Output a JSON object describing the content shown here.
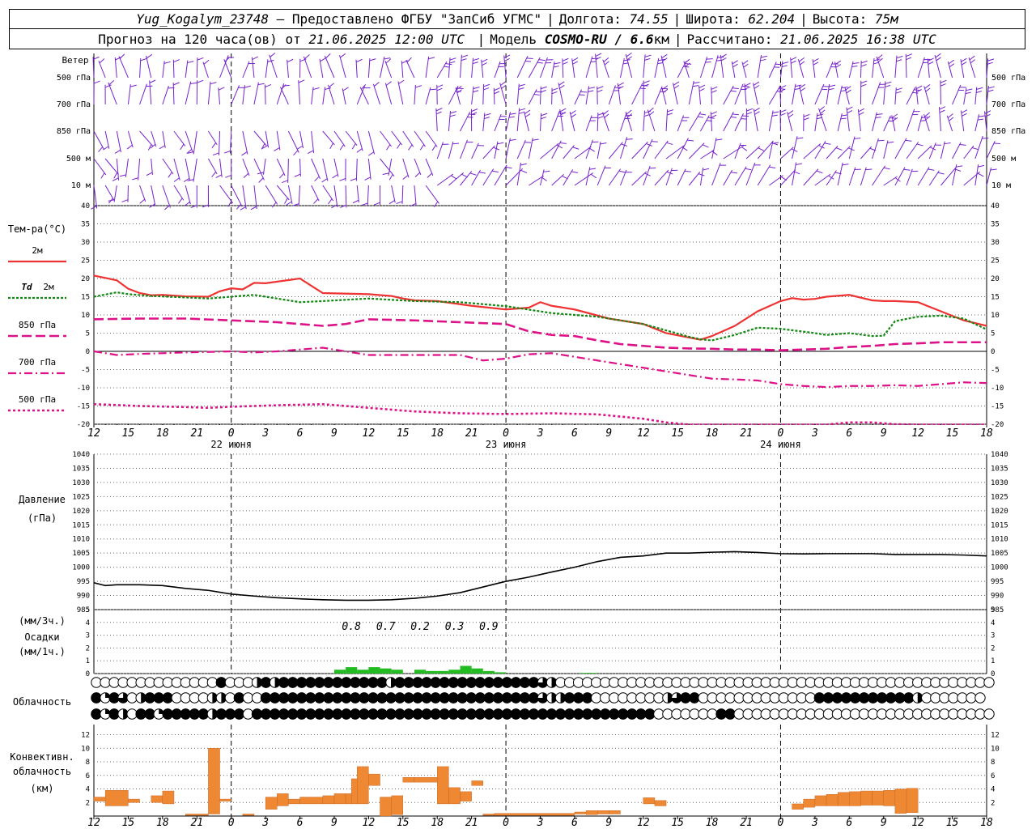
{
  "header": {
    "station": "Yug_Kogalym_23748",
    "provided": "— Предоставлено ФГБУ \"ЗапСиб УГМС\"",
    "lon_label": "Долгота:",
    "lon": "74.55",
    "lat_label": "Широта:",
    "lat": "62.204",
    "alt_label": "Высота:",
    "alt": "75м",
    "forecast_prefix": "Прогноз на 120 часа(ов) от",
    "forecast_time": "21.06.2025 12:00 UTC",
    "model_label": "Модель",
    "model": "COSMO-RU / 6.6",
    "model_unit": "км",
    "calc_label": "Рассчитано:",
    "calc_time": "21.06.2025 16:38 UTC"
  },
  "colors": {
    "t2m": "#ee3333",
    "td2m": "#118811",
    "t850": "#dd1188",
    "t700": "#dd1188",
    "t500": "#dd1188",
    "wind": "#7722cc",
    "pressure": "#000000",
    "precip": "#22bb22",
    "convective": "#ee8833"
  },
  "panels": {
    "wind": {
      "title": "Ветер",
      "levels": [
        "500 гПа",
        "700 гПа",
        "850 гПа",
        "500 м",
        "10 м"
      ]
    },
    "temperature": {
      "title": "Тем-ра(°C)",
      "legend": [
        {
          "label": "2м",
          "key": "t2m"
        },
        {
          "label": "Td 2м",
          "key": "td2m"
        },
        {
          "label": "850 гПа",
          "key": "t850"
        },
        {
          "label": "700 гПа",
          "key": "t700"
        },
        {
          "label": "500 гПа",
          "key": "t500"
        }
      ]
    },
    "pressure": {
      "title": "Давление",
      "unit": "(гПа)"
    },
    "precip": {
      "unit3": "(мм/3ч.)",
      "title": "Осадки",
      "unit1": "(мм/1ч.)"
    },
    "cloud": {
      "title": "Облачность"
    },
    "convective": {
      "title": "Конвективн. облачность",
      "unit": "(км)"
    }
  },
  "chart_data": [
    {
      "type": "line",
      "title": "Тем-ра(°C)",
      "ylim": [
        -20,
        40
      ],
      "yticks": [
        -20,
        -15,
        -10,
        -5,
        0,
        5,
        10,
        15,
        20,
        25,
        30,
        35,
        40
      ],
      "x_tick_labels": [
        "12",
        "15",
        "18",
        "21",
        "0",
        "3",
        "6",
        "9",
        "12",
        "15",
        "18",
        "21",
        "0",
        "3",
        "6",
        "9",
        "12",
        "15",
        "18",
        "21",
        "0",
        "3",
        "6",
        "9",
        "12",
        "15",
        "18"
      ],
      "date_labels": [
        {
          "hour": 12,
          "text": "22 июня"
        },
        {
          "hour": 36,
          "text": "23 июня"
        },
        {
          "hour": 60,
          "text": "24 июня"
        }
      ],
      "x_range_hours": [
        0,
        78
      ],
      "series": [
        {
          "name": "2м",
          "key": "t2m",
          "x": [
            0,
            2,
            3,
            4,
            5,
            6,
            8,
            10,
            11,
            12,
            13,
            14,
            15,
            18,
            20,
            24,
            26,
            27,
            28,
            30,
            33,
            36,
            38,
            39,
            40,
            42,
            45,
            48,
            50,
            52,
            53,
            54,
            56,
            58,
            60,
            61,
            62,
            63,
            64,
            66,
            68,
            69,
            70,
            72,
            74,
            76,
            78
          ],
          "y": [
            20.8,
            19.5,
            17.2,
            16,
            15.4,
            15.5,
            15.1,
            15,
            16.5,
            17.3,
            17,
            18.8,
            18.7,
            20,
            16,
            15.7,
            15.2,
            14.5,
            14,
            13.8,
            12.5,
            11.5,
            12,
            13.5,
            12.5,
            11.5,
            9,
            7.5,
            5,
            3.8,
            3.2,
            4.2,
            7,
            11,
            13.8,
            14.6,
            14.2,
            14.4,
            15,
            15.5,
            14,
            13.8,
            13.8,
            13.5,
            11,
            8.5,
            7
          ]
        },
        {
          "name": "Td 2м",
          "key": "td2m",
          "x": [
            0,
            2,
            3,
            5,
            8,
            10,
            12,
            14,
            15,
            18,
            20,
            24,
            28,
            32,
            36,
            40,
            44,
            48,
            52,
            53,
            54,
            56,
            58,
            60,
            63,
            64,
            66,
            68,
            69,
            70,
            72,
            74,
            76,
            78
          ],
          "y": [
            15,
            16.2,
            15.7,
            15.2,
            14.8,
            14.5,
            15,
            15.5,
            15,
            13.5,
            13.8,
            14.5,
            13.8,
            13.5,
            12.4,
            10.5,
            9.5,
            7.5,
            4,
            3.3,
            3,
            4.5,
            6.5,
            6.2,
            5,
            4.5,
            5,
            4.2,
            4.3,
            8.3,
            9.5,
            9.8,
            9,
            6
          ]
        },
        {
          "name": "850 гПа",
          "key": "t850",
          "x": [
            0,
            4,
            8,
            12,
            16,
            20,
            22,
            24,
            28,
            32,
            36,
            38,
            40,
            42,
            44,
            46,
            48,
            50,
            52,
            54,
            56,
            58,
            60,
            62,
            64,
            66,
            68,
            70,
            72,
            74,
            76,
            78
          ],
          "y": [
            8.8,
            9,
            9,
            8.5,
            8,
            7,
            7.5,
            8.8,
            8.5,
            8,
            7.5,
            5.5,
            4.5,
            4.2,
            3,
            2,
            1.5,
            1,
            0.8,
            0.7,
            0.5,
            0.5,
            0.3,
            0.5,
            0.7,
            1.2,
            1.5,
            2,
            2.2,
            2.5,
            2.5,
            2.5
          ]
        },
        {
          "name": "700 гПа",
          "key": "t700",
          "x": [
            0,
            2,
            4,
            8,
            12,
            14,
            16,
            20,
            24,
            28,
            32,
            34,
            36,
            38,
            40,
            44,
            46,
            48,
            50,
            52,
            54,
            56,
            58,
            60,
            62,
            64,
            66,
            68,
            70,
            72,
            74,
            76,
            78
          ],
          "y": [
            0,
            -1,
            -0.7,
            -0.3,
            0,
            -0.3,
            0,
            1,
            -1,
            -1,
            -1,
            -2.5,
            -2,
            -0.8,
            -0.5,
            -2.5,
            -3.5,
            -4.5,
            -5.5,
            -6.5,
            -7.5,
            -7.7,
            -8,
            -9,
            -9.5,
            -9.8,
            -9.5,
            -9.5,
            -9.3,
            -9.5,
            -9,
            -8.5,
            -8.7
          ]
        },
        {
          "name": "500 гПа",
          "key": "t500",
          "x": [
            0,
            4,
            8,
            10,
            12,
            16,
            20,
            24,
            28,
            32,
            36,
            40,
            44,
            48,
            50,
            52,
            54,
            56,
            58,
            60,
            62,
            64,
            66,
            68,
            70,
            72,
            74,
            76,
            78
          ],
          "y": [
            -14.5,
            -15,
            -15.3,
            -15.5,
            -15.2,
            -14.8,
            -14.5,
            -15.5,
            -16.5,
            -17,
            -17.2,
            -17,
            -17.3,
            -18.5,
            -19.5,
            -20.5,
            -21.5,
            -22,
            -22,
            -22,
            -21.5,
            -20.3,
            -19.5,
            -19.5,
            -20,
            -20.5,
            -21,
            -21.5,
            -22
          ]
        }
      ]
    },
    {
      "type": "line",
      "title": "Давление",
      "ylabel": "(гПа)",
      "ylim": [
        985,
        1040
      ],
      "yticks": [
        985,
        990,
        995,
        1000,
        1005,
        1010,
        1015,
        1020,
        1025,
        1030,
        1035,
        1040
      ],
      "series": [
        {
          "name": "Давление",
          "key": "pressure",
          "x": [
            0,
            1,
            2,
            4,
            6,
            8,
            10,
            12,
            14,
            16,
            18,
            20,
            22,
            24,
            26,
            28,
            30,
            32,
            34,
            36,
            38,
            40,
            42,
            44,
            46,
            48,
            50,
            52,
            54,
            56,
            58,
            60,
            62,
            64,
            66,
            68,
            70,
            72,
            74,
            76,
            78
          ],
          "y": [
            994.5,
            993.5,
            993.8,
            993.8,
            993.5,
            992.5,
            991.8,
            990.5,
            989.8,
            989.2,
            988.8,
            988.5,
            988.3,
            988.3,
            988.5,
            989,
            989.8,
            991,
            993,
            995,
            996.5,
            998.3,
            1000,
            1002,
            1003.5,
            1004,
            1005,
            1005,
            1005.3,
            1005.5,
            1005.2,
            1004.8,
            1004.7,
            1004.8,
            1004.8,
            1004.8,
            1004.5,
            1004.5,
            1004.5,
            1004.3,
            1004
          ]
        }
      ]
    },
    {
      "type": "bar",
      "title": "Осадки",
      "ylabel": "(мм/3ч.) (мм/1ч.)",
      "ylim": [
        0,
        5
      ],
      "yticks": [
        0,
        1,
        2,
        3,
        4,
        5
      ],
      "annotations": [
        {
          "hour": 22.5,
          "text": "0.8"
        },
        {
          "hour": 25.5,
          "text": "0.7"
        },
        {
          "hour": 28.5,
          "text": "0.2"
        },
        {
          "hour": 31.5,
          "text": "0.3"
        },
        {
          "hour": 34.5,
          "text": "0.9"
        }
      ],
      "series": [
        {
          "name": "Осадки",
          "key": "precip",
          "x": [
            21,
            22,
            23,
            24,
            25,
            26,
            27,
            28,
            29,
            30,
            31,
            32,
            33,
            34,
            35,
            42.5,
            43
          ],
          "y": [
            0.3,
            0.5,
            0.3,
            0.5,
            0.4,
            0.3,
            0,
            0.3,
            0.2,
            0.2,
            0.3,
            0.6,
            0.4,
            0.2,
            0.1,
            0.05,
            0.05
          ]
        }
      ]
    },
    {
      "type": "table",
      "title": "Облачность",
      "rows": {
        "low": "000000000000008000C8C888888888888C88888888888888886C00000000000000000000000000000000000000000000000000",
        "mid": "8286048880000CC080088888888888888888888888888888886C488800000000C68800000000000008888888888840000000",
        "high": "8284088288888C8880888888888888888888888888888888888888888888888000000088000000000000000000000000000000"
      }
    },
    {
      "type": "bar",
      "title": "Конвективн. облачность",
      "ylabel": "(км)",
      "ylim": [
        0,
        12
      ],
      "yticks": [
        2,
        4,
        6,
        8,
        10,
        12
      ],
      "series": [
        {
          "name": "Конвективн. облачность",
          "key": "convective",
          "bars": [
            [
              0,
              1,
              2.2,
              2.8
            ],
            [
              1,
              3,
              1.5,
              3.8
            ],
            [
              3,
              4,
              2,
              2.5
            ],
            [
              5,
              6,
              2,
              3
            ],
            [
              6,
              7,
              1.8,
              3.7
            ],
            [
              8,
              10,
              0.1,
              0.3
            ],
            [
              10,
              11,
              0.3,
              10
            ],
            [
              11,
              12,
              2.2,
              2.5
            ],
            [
              13,
              14,
              0.1,
              0.3
            ],
            [
              15,
              16,
              1,
              2.8
            ],
            [
              16,
              17,
              1.5,
              3.3
            ],
            [
              17,
              18,
              1.8,
              2.5
            ],
            [
              18,
              20,
              1.8,
              2.8
            ],
            [
              20,
              21,
              1.8,
              3
            ],
            [
              21,
              22,
              1.8,
              3.3
            ],
            [
              22,
              22.5,
              1.8,
              3.3
            ],
            [
              22.5,
              23,
              1.8,
              5.5
            ],
            [
              23,
              24,
              1.8,
              7.3
            ],
            [
              24,
              25,
              4.5,
              6.2
            ],
            [
              25,
              26,
              0,
              2.8
            ],
            [
              26,
              27,
              0.2,
              3
            ],
            [
              27,
              28,
              5,
              5.7
            ],
            [
              28,
              30,
              5,
              5.7
            ],
            [
              30,
              31,
              1.8,
              7.3
            ],
            [
              31,
              32,
              1.8,
              4.2
            ],
            [
              32,
              33,
              2.2,
              3.6
            ],
            [
              33,
              34,
              4.5,
              5.2
            ],
            [
              34,
              35,
              0.1,
              0.3
            ],
            [
              35,
              42,
              0.1,
              0.4
            ],
            [
              42,
              43,
              0.3,
              0.6
            ],
            [
              43,
              44,
              0.2,
              0.8
            ],
            [
              44,
              45,
              0.3,
              0.8
            ],
            [
              45,
              46,
              0.3,
              0.8
            ],
            [
              48,
              49,
              1.8,
              2.7
            ],
            [
              49,
              50,
              1.5,
              2.3
            ],
            [
              61,
              62,
              1,
              1.8
            ],
            [
              62,
              63,
              1.3,
              2.5
            ],
            [
              63,
              64,
              1.5,
              3
            ],
            [
              64,
              65,
              1.5,
              3.2
            ],
            [
              65,
              66,
              1.5,
              3.5
            ],
            [
              66,
              67,
              1.5,
              3.6
            ],
            [
              67,
              68,
              1.6,
              3.7
            ],
            [
              68,
              69,
              1.6,
              3.7
            ],
            [
              69,
              70,
              1.5,
              3.8
            ],
            [
              70,
              71,
              0.4,
              4
            ],
            [
              71,
              72,
              0.5,
              4.1
            ]
          ]
        }
      ]
    }
  ]
}
